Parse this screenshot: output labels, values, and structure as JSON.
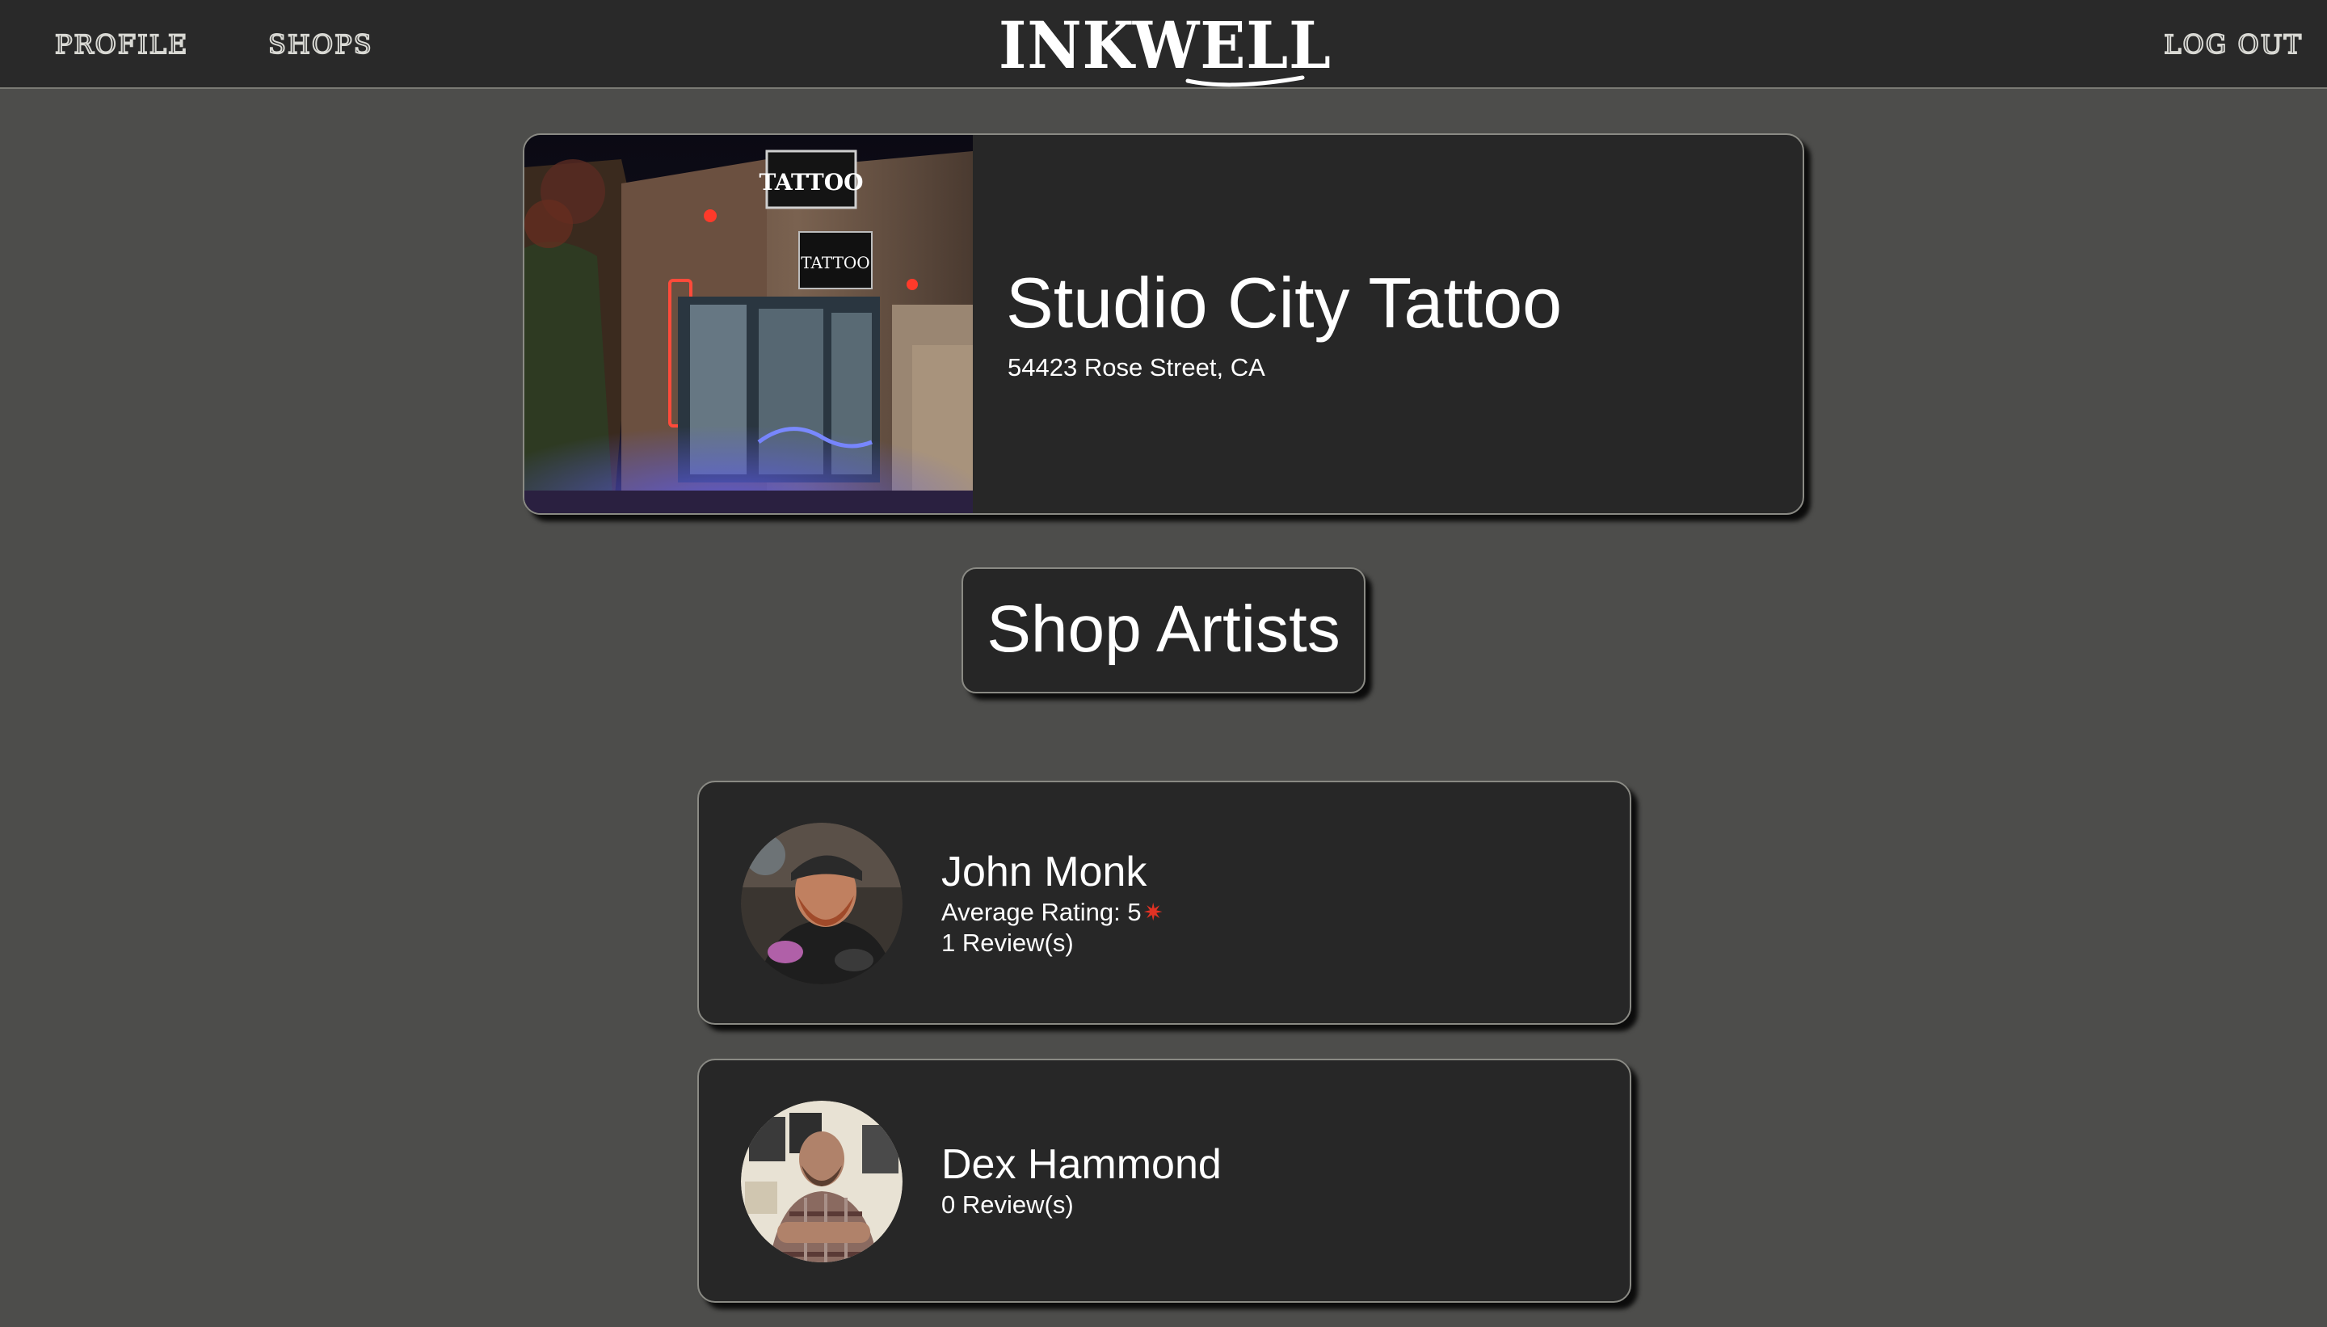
{
  "nav": {
    "profile_label": "PROFILE",
    "shops_label": "SHOPS",
    "logo_text": "INKWELL",
    "logout_label": "LOG OUT"
  },
  "shop": {
    "name": "Studio City Tattoo",
    "address": "54423 Rose Street, CA",
    "photo_sign_text": "TATTOO"
  },
  "section": {
    "title": "Shop Artists"
  },
  "artists": [
    {
      "name": "John Monk",
      "rating_label": "Average Rating: 5",
      "rating_icon": "star-icon",
      "reviews": "1 Review(s)"
    },
    {
      "name": "Dex Hammond",
      "reviews": "0 Review(s)"
    }
  ],
  "colors": {
    "page_bg": "#4d4d4b",
    "card_bg": "#272727",
    "nav_bg": "#292929",
    "card_border": "#8a8a84",
    "star": "#e03224"
  }
}
